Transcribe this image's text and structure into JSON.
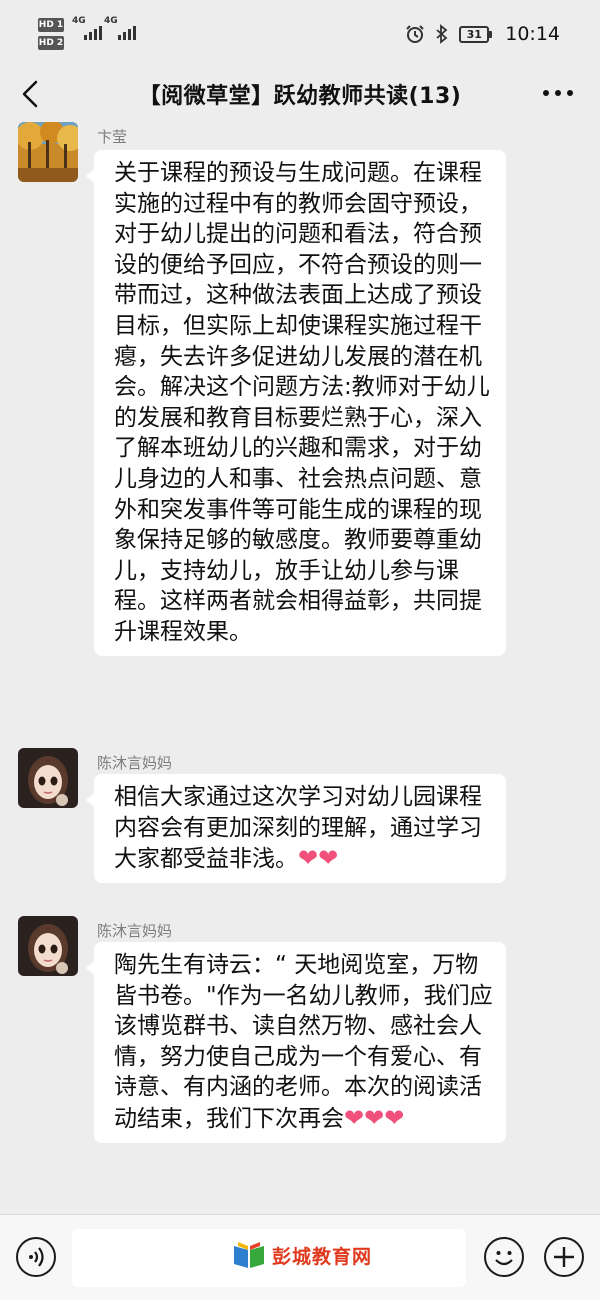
{
  "status_bar": {
    "sim1": "HD 1",
    "sim2": "HD 2",
    "net1": "4G",
    "net2": "4G",
    "battery": "31",
    "time": "10:14",
    "icons": [
      "alarm-icon",
      "bluetooth-icon",
      "battery-icon"
    ]
  },
  "header": {
    "title": "【阅微草堂】跃幼教师共读(13)",
    "back_icon": "chevron-left-icon",
    "more_icon": "more-dots-icon"
  },
  "messages": [
    {
      "sender": "卞莹",
      "avatar": "autumn-trees-avatar",
      "text": "关于课程的预设与生成问题。在课程实施的过程中有的教师会固守预设，对于幼儿提出的问题和看法，符合预设的便给予回应，不符合预设的则一带而过，这种做法表面上达成了预设目标，但实际上却使课程实施过程干瘪，失去许多促进幼儿发展的潜在机会。解决这个问题方法:教师对于幼儿的发展和教育目标要烂熟于心，深入了解本班幼儿的兴趣和需求，对于幼儿身边的人和事、社会热点问题、意外和突发事件等可能生成的课程的现象保持足够的敏感度。教师要尊重幼儿，支持幼儿，放手让幼儿参与课程。这样两者就会相得益彰，共同提升课程效果。"
    },
    {
      "sender": "陈沐言妈妈",
      "avatar": "cartoon-girl-avatar",
      "text": "相信大家通过这次学习对幼儿园课程内容会有更加深刻的理解，通过学习大家都受益非浅。",
      "trailing": "❤❤"
    },
    {
      "sender": "陈沐言妈妈",
      "avatar": "cartoon-girl-avatar",
      "text": "陶先生有诗云：“ 天地阅览室，万物皆书卷。\"作为一名幼儿教师，我们应该博览群书、读自然万物、感社会人情，努力使自己成为一个有爱心、有诗意、有内涵的老师。本次的阅读活动结束，我们下次再会",
      "trailing": "❤❤❤"
    }
  ],
  "input_bar": {
    "voice_icon": "voice-icon",
    "emoji_icon": "emoji-icon",
    "plus_icon": "plus-icon",
    "watermark": "彭城教育网"
  },
  "colors": {
    "background": "#ededed",
    "bubble": "#ffffff",
    "sender": "#7d7d7d",
    "heart": "#f0507a",
    "watermark": "#e03a1e"
  }
}
